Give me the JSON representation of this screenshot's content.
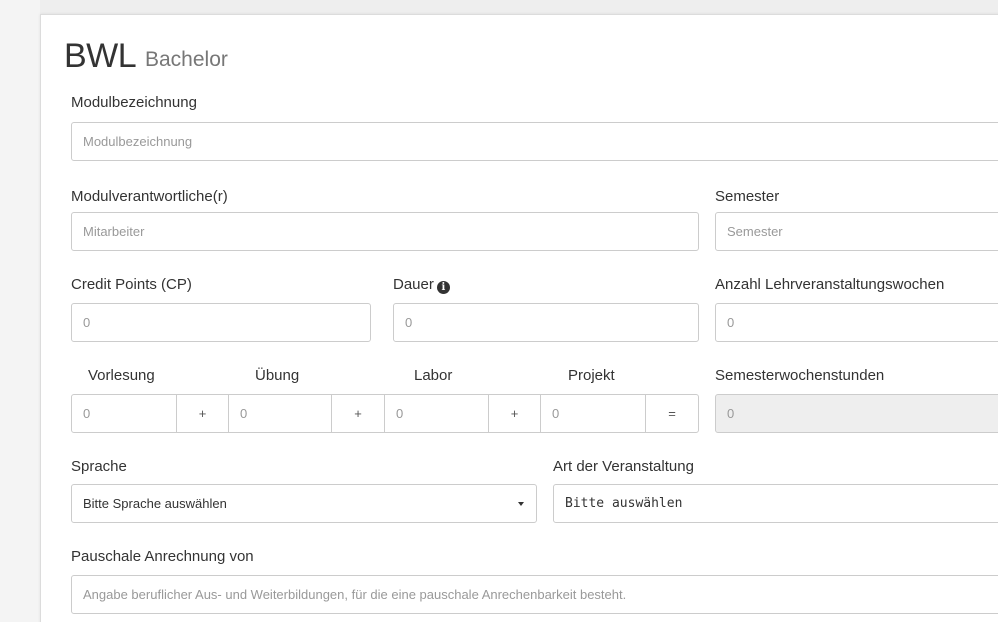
{
  "header": {
    "title": "BWL",
    "subtitle": "Bachelor"
  },
  "modul": {
    "label": "Modulbezeichnung",
    "placeholder": "Modulbezeichnung"
  },
  "verantwortlich": {
    "label": "Modulverantwortliche(r)",
    "placeholder": "Mitarbeiter"
  },
  "semester": {
    "label": "Semester",
    "placeholder": "Semester"
  },
  "credit_points": {
    "label": "Credit Points (CP)",
    "placeholder": "0"
  },
  "dauer": {
    "label": "Dauer",
    "placeholder": "0",
    "icon": "info-icon"
  },
  "wochen": {
    "label": "Anzahl Lehrveranstaltungswochen",
    "placeholder": "0"
  },
  "hours": {
    "vorlesung": {
      "label": "Vorlesung",
      "placeholder": "0"
    },
    "uebung": {
      "label": "Übung",
      "placeholder": "0"
    },
    "labor": {
      "label": "Labor",
      "placeholder": "0"
    },
    "projekt": {
      "label": "Projekt",
      "placeholder": "0"
    },
    "plus": "+",
    "equals": "=",
    "sws": {
      "label": "Semesterwochenstunden",
      "placeholder": "0"
    }
  },
  "sprache": {
    "label": "Sprache",
    "selected": "Bitte Sprache auswählen"
  },
  "art": {
    "label": "Art der Veranstaltung",
    "selected": "Bitte auswählen"
  },
  "pauschale": {
    "label": "Pauschale Anrechnung von",
    "placeholder": "Angabe beruflicher Aus- und Weiterbildungen, für die eine pauschale Anrechenbarkeit besteht."
  }
}
